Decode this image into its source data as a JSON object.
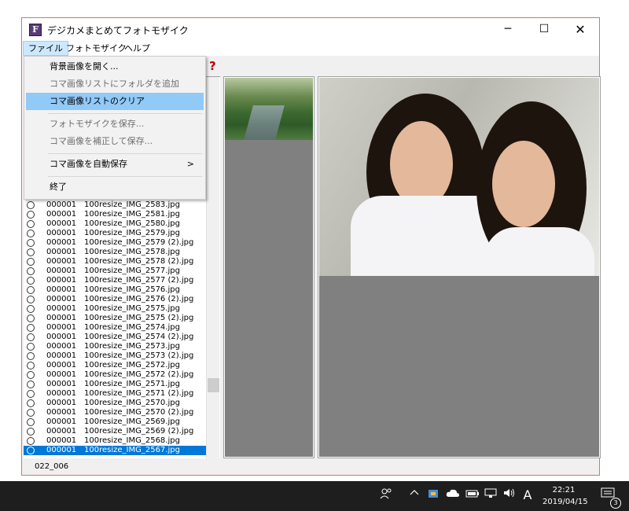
{
  "window": {
    "title": "デジカメまとめてフォトモザイク",
    "app_icon_letter": "F"
  },
  "caption_buttons": {
    "minimize": "─",
    "maximize": "☐",
    "close": "✕"
  },
  "menubar": {
    "file": "ファイル",
    "mosaic": "フォトモザイク",
    "help": "ヘルプ"
  },
  "toolbar": {
    "help_icon": "?"
  },
  "file_menu": {
    "open_background": "背景画像を開く...",
    "add_folder": "コマ画像リストにフォルダを追加",
    "clear_list": "コマ画像リストのクリア",
    "save_mosaic": "フォトモザイクを保存...",
    "correct_save": "コマ画像を補正して保存...",
    "auto_save": "コマ画像を自動保存",
    "auto_save_arrow": ">",
    "exit": "終了"
  },
  "image_list": [
    {
      "num": "000001",
      "name": "100resize_IMG_2583.jpg"
    },
    {
      "num": "000001",
      "name": "100resize_IMG_2581.jpg"
    },
    {
      "num": "000001",
      "name": "100resize_IMG_2580.jpg"
    },
    {
      "num": "000001",
      "name": "100resize_IMG_2579.jpg"
    },
    {
      "num": "000001",
      "name": "100resize_IMG_2579 (2).jpg"
    },
    {
      "num": "000001",
      "name": "100resize_IMG_2578.jpg"
    },
    {
      "num": "000001",
      "name": "100resize_IMG_2578 (2).jpg"
    },
    {
      "num": "000001",
      "name": "100resize_IMG_2577.jpg"
    },
    {
      "num": "000001",
      "name": "100resize_IMG_2577 (2).jpg"
    },
    {
      "num": "000001",
      "name": "100resize_IMG_2576.jpg"
    },
    {
      "num": "000001",
      "name": "100resize_IMG_2576 (2).jpg"
    },
    {
      "num": "000001",
      "name": "100resize_IMG_2575.jpg"
    },
    {
      "num": "000001",
      "name": "100resize_IMG_2575 (2).jpg"
    },
    {
      "num": "000001",
      "name": "100resize_IMG_2574.jpg"
    },
    {
      "num": "000001",
      "name": "100resize_IMG_2574 (2).jpg"
    },
    {
      "num": "000001",
      "name": "100resize_IMG_2573.jpg"
    },
    {
      "num": "000001",
      "name": "100resize_IMG_2573 (2).jpg"
    },
    {
      "num": "000001",
      "name": "100resize_IMG_2572.jpg"
    },
    {
      "num": "000001",
      "name": "100resize_IMG_2572 (2).jpg"
    },
    {
      "num": "000001",
      "name": "100resize_IMG_2571.jpg"
    },
    {
      "num": "000001",
      "name": "100resize_IMG_2571 (2).jpg"
    },
    {
      "num": "000001",
      "name": "100resize_IMG_2570.jpg"
    },
    {
      "num": "000001",
      "name": "100resize_IMG_2570 (2).jpg"
    },
    {
      "num": "000001",
      "name": "100resize_IMG_2569.jpg"
    },
    {
      "num": "000001",
      "name": "100resize_IMG_2569 (2).jpg"
    },
    {
      "num": "000001",
      "name": "100resize_IMG_2568.jpg"
    },
    {
      "num": "000001",
      "name": "100resize_IMG_2567.jpg",
      "selected": true
    }
  ],
  "statusbar": {
    "text": "022_006"
  },
  "taskbar": {
    "clock_time": "22:21",
    "clock_date": "2019/04/15",
    "ime_indicator": "A",
    "notification_count": "3"
  },
  "colors": {
    "selection": "#0078d7",
    "menu_highlight": "#91c9f7",
    "window_border": "#c87c68",
    "taskbar": "#1e1e1e"
  }
}
